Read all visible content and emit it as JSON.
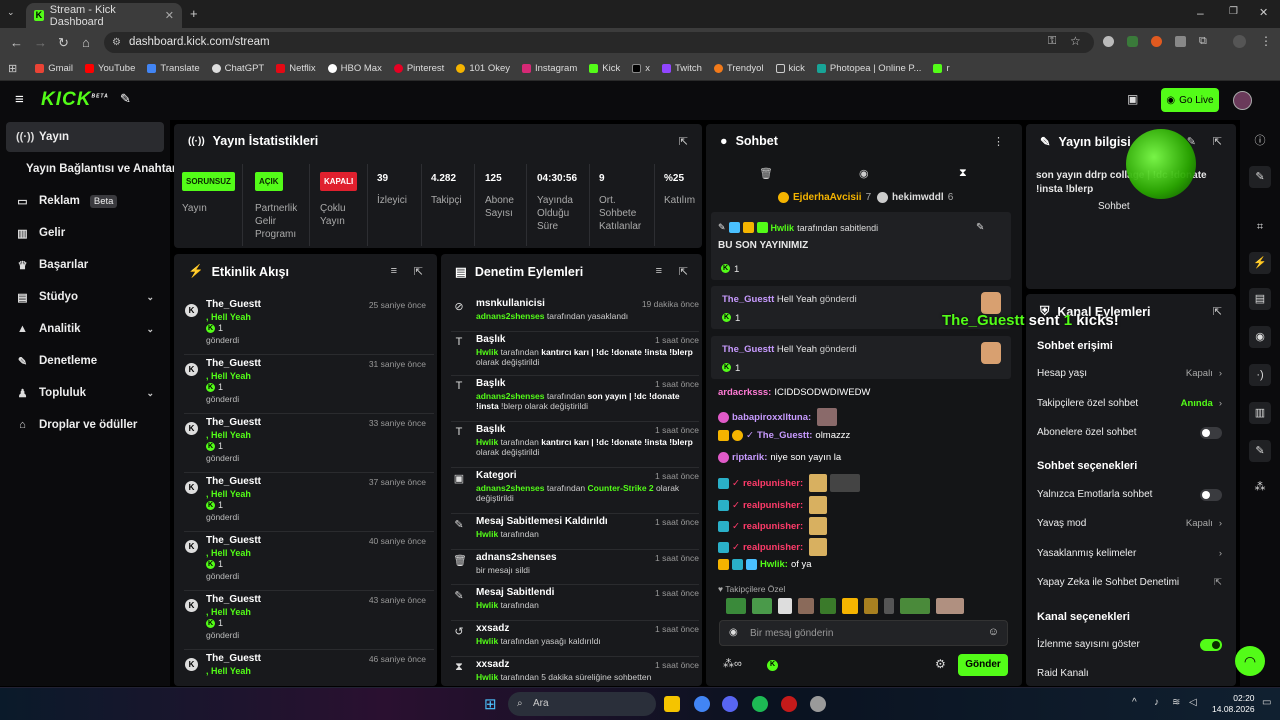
{
  "browser": {
    "tab_title": "Stream - Kick Dashboard",
    "url": "dashboard.kick.com/stream",
    "bookmarks": [
      "Gmail",
      "YouTube",
      "Translate",
      "ChatGPT",
      "Netflix",
      "HBO Max",
      "Pinterest",
      "101 Okey",
      "Instagram",
      "Kick",
      "x",
      "Twitch",
      "Trendyol",
      "kick",
      "Photopea | Online P...",
      "r"
    ]
  },
  "header": {
    "logo": "KICK",
    "logo_sup": "BETA",
    "go_live": "Go Live"
  },
  "sidebar": {
    "items": [
      {
        "label": "Yayın"
      },
      {
        "label": "Yayın Bağlantısı ve Anahtarı"
      },
      {
        "label": "Reklam",
        "badge": "Beta"
      },
      {
        "label": "Gelir"
      },
      {
        "label": "Başarılar"
      },
      {
        "label": "Stüdyo"
      },
      {
        "label": "Analitik"
      },
      {
        "label": "Denetleme"
      },
      {
        "label": "Topluluk"
      },
      {
        "label": "Droplar ve ödüller"
      }
    ]
  },
  "stats": {
    "title": "Yayın İstatistikleri",
    "yayin": {
      "badge": "SORUNSUZ",
      "label": "Yayın"
    },
    "partner": {
      "badge": "AÇIK",
      "label": "Partnerlik Gelir Programı"
    },
    "coklu": {
      "badge": "KAPALI",
      "label": "Çoklu Yayın"
    },
    "viewers": {
      "value": "39",
      "label": "İzleyici"
    },
    "followers": {
      "value": "4.282",
      "label": "Takipçi"
    },
    "subs": {
      "value": "125",
      "label": "Abone Sayısı"
    },
    "uptime": {
      "value": "04:30:56",
      "label": "Yayında Olduğu Süre"
    },
    "avg_chat": {
      "value": "9",
      "label": "Ort. Sohbete Katılanlar"
    },
    "participation": {
      "value": "%25",
      "label": "Katılım"
    }
  },
  "activity": {
    "title": "Etkinlik Akışı",
    "items": [
      {
        "name": "The_Guestt",
        "msg": ", Hell Yeah",
        "count": "1",
        "sent": "gönderdi",
        "time": "25 saniye önce"
      },
      {
        "name": "The_Guestt",
        "msg": ", Hell Yeah",
        "count": "1",
        "sent": "gönderdi",
        "time": "31 saniye önce"
      },
      {
        "name": "The_Guestt",
        "msg": ", Hell Yeah",
        "count": "1",
        "sent": "gönderdi",
        "time": "33 saniye önce"
      },
      {
        "name": "The_Guestt",
        "msg": ", Hell Yeah",
        "count": "1",
        "sent": "gönderdi",
        "time": "37 saniye önce"
      },
      {
        "name": "The_Guestt",
        "msg": ", Hell Yeah",
        "count": "1",
        "sent": "gönderdi",
        "time": "40 saniye önce"
      },
      {
        "name": "The_Guestt",
        "msg": ", Hell Yeah",
        "count": "1",
        "sent": "gönderdi",
        "time": "43 saniye önce"
      },
      {
        "name": "The_Guestt",
        "msg": ", Hell Yeah",
        "count": "",
        "sent": "",
        "time": "46 saniye önce"
      }
    ]
  },
  "moderation": {
    "title": "Denetim Eylemleri",
    "items": [
      {
        "title": "msnkullanicisi",
        "time": "19 dakika önce",
        "user": "adnans2shenses",
        "desc": " tarafından yasaklandı",
        "extra": "",
        "extra2": ""
      },
      {
        "title": "Başlık",
        "time": "1 saat önce",
        "user": "Hwlik",
        "desc": " tarafından ",
        "extra": "kantırcı karı | !dc !donate !insta !blerp",
        "extra2": "olarak değiştirildi"
      },
      {
        "title": "Başlık",
        "time": "1 saat önce",
        "user": "adnans2shenses",
        "desc": " tarafından ",
        "extra": "son yayın | !dc !donate !insta",
        "extra2": "!blerp olarak değiştirildi"
      },
      {
        "title": "Başlık",
        "time": "1 saat önce",
        "user": "Hwlik",
        "desc": " tarafından ",
        "extra": "kantırcı karı | !dc !donate !insta !blerp",
        "extra2": "olarak değiştirildi"
      },
      {
        "title": "Kategori",
        "time": "1 saat önce",
        "user": "adnans2shenses",
        "desc": " tarafından ",
        "extra": "Counter-Strike 2",
        "extra2": "olarak değiştirildi"
      },
      {
        "title": "Mesaj Sabitlemesi Kaldırıldı",
        "time": "1 saat önce",
        "user": "Hwlik",
        "desc": " tarafından",
        "extra": "",
        "extra2": ""
      },
      {
        "title": "adnans2shenses",
        "time": "1 saat önce",
        "user": "",
        "desc": "bir mesajı sildi",
        "extra": "",
        "extra2": ""
      },
      {
        "title": "Mesaj Sabitlendi",
        "time": "1 saat önce",
        "user": "Hwlik",
        "desc": " tarafından",
        "extra": "",
        "extra2": ""
      },
      {
        "title": "xxsadz",
        "time": "1 saat önce",
        "user": "Hwlik",
        "desc": " tarafından yasağı kaldırıldı",
        "extra": "",
        "extra2": ""
      },
      {
        "title": "xxsadz",
        "time": "1 saat önce",
        "user": "Hwlik",
        "desc": " tarafından 5 dakika süreliğine sohbetten",
        "extra": "",
        "extra2": ""
      }
    ]
  },
  "chat": {
    "title": "Sohbet",
    "top1": {
      "name": "EjderhaAvcisii",
      "count": "7"
    },
    "top2": {
      "name": "hekimwddl",
      "count": "6"
    },
    "pinned": {
      "by": "Hwlik",
      "by_suffix": "tarafından sabitlendi",
      "text": "BU SON YAYINIMIZ",
      "count": "1"
    },
    "kicks": [
      {
        "user": "The_Guestt",
        "msg": "Hell Yeah",
        "verb": "gönderdi",
        "count": "1"
      },
      {
        "user": "The_Guestt",
        "msg": "Hell Yeah",
        "verb": "gönderdi",
        "count": "1"
      }
    ],
    "messages": [
      {
        "user": "ardacrksss:",
        "text": "ICIDDSODWDIWEDW",
        "color": "#ff7bd5"
      },
      {
        "user": "babapiroxxlltuna:",
        "text": "",
        "color": "#c89bff"
      },
      {
        "user": "The_Guestt:",
        "text": "olmazzz",
        "color": "#c89bff"
      },
      {
        "user": "riptarik:",
        "text": "niye son yayın la",
        "color": "#c89bff"
      },
      {
        "user": "realpunisher:",
        "text": "",
        "color": "#ff3b6a"
      },
      {
        "user": "realpunisher:",
        "text": "",
        "color": "#ff3b6a"
      },
      {
        "user": "realpunisher:",
        "text": "",
        "color": "#ff3b6a"
      },
      {
        "user": "realpunisher:",
        "text": "",
        "color": "#ff3b6a"
      },
      {
        "user": "Hwlik:",
        "text": "of ya",
        "color": "#53fc18"
      }
    ],
    "followers_only": "Takipçilere Özel",
    "input_placeholder": "Bir mesaj gönderin",
    "send": "Gönder",
    "overlay": {
      "user": "The_Guestt",
      "mid": " sent ",
      "count": "1",
      "end": " kicks!"
    }
  },
  "stream_info": {
    "title": "Yayın bilgisi",
    "text": "son yayın ddrp collage | !dc !donate !insta !blerp",
    "sub": "Sohbet"
  },
  "channel": {
    "title": "Kanal Eylemleri",
    "chat_access": "Sohbet erişimi",
    "account_age": {
      "label": "Hesap yaşı",
      "value": "Kapalı"
    },
    "followers_chat": {
      "label": "Takipçilere özel sohbet",
      "value": "Anında"
    },
    "subs_chat": {
      "label": "Abonelere özel sohbet"
    },
    "chat_options": "Sohbet seçenekleri",
    "emotes_only": {
      "label": "Yalnızca Emotlarla sohbet"
    },
    "slow_mode": {
      "label": "Yavaş mod",
      "value": "Kapalı"
    },
    "banned_words": {
      "label": "Yasaklanmış kelimeler"
    },
    "ai_mod": {
      "label": "Yapay Zeka ile Sohbet Denetimi"
    },
    "channel_options": "Kanal seçenekleri",
    "show_viewers": {
      "label": "İzlenme sayısını göster"
    },
    "raid": {
      "label": "Raid Kanalı"
    }
  },
  "taskbar": {
    "search": "Ara",
    "time": "02:20",
    "date": "14.08.2026"
  },
  "colors": {
    "accent": "#53fc18",
    "panel": "#18191c",
    "bg": "#0b0b0d",
    "danger": "#e0202e"
  }
}
